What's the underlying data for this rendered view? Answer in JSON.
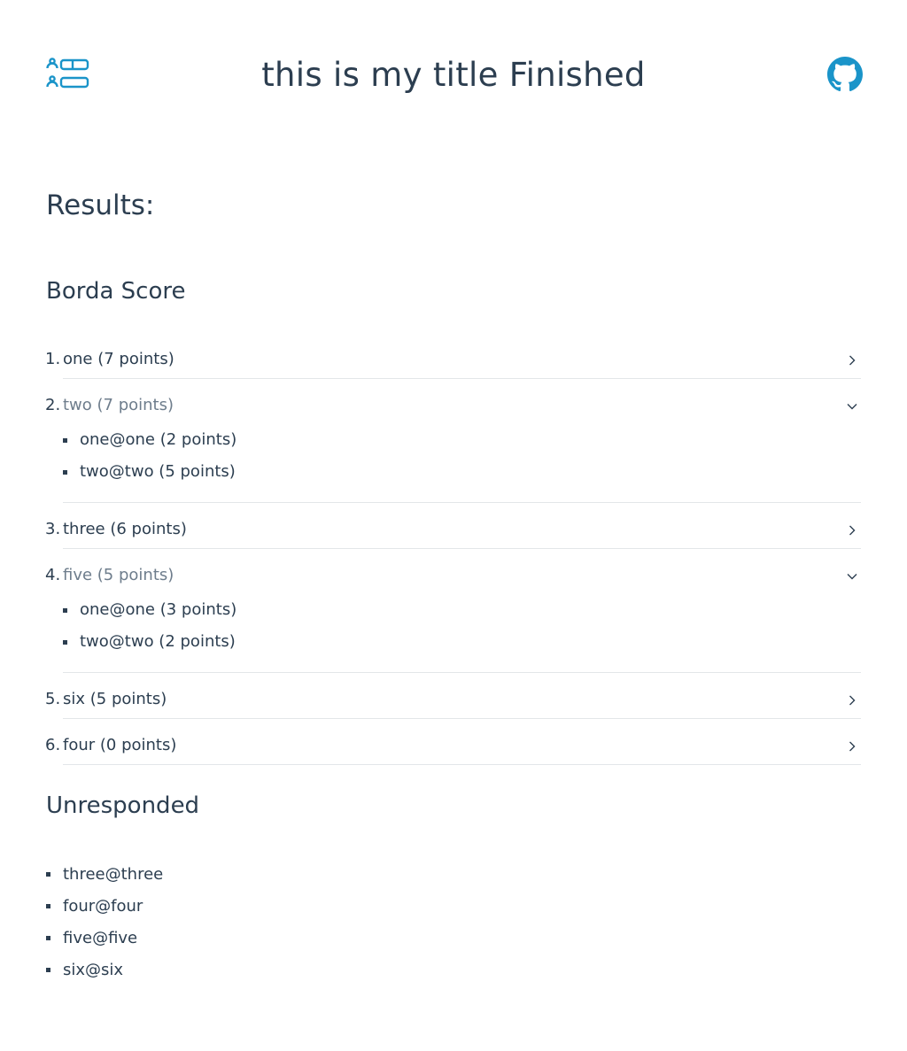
{
  "header": {
    "title": "this is my title Finished",
    "logo_icon": "ranked-list-logo-icon",
    "github_icon": "github-icon",
    "accent_color": "#1a94c9"
  },
  "results": {
    "heading": "Results:"
  },
  "borda": {
    "heading": "Borda Score",
    "items": [
      {
        "rank": "1.",
        "label": "one (7 points)",
        "expanded": false,
        "voters": []
      },
      {
        "rank": "2.",
        "label": "two (7 points)",
        "expanded": true,
        "voters": [
          "one@one (2 points)",
          "two@two (5 points)"
        ]
      },
      {
        "rank": "3.",
        "label": "three (6 points)",
        "expanded": false,
        "voters": []
      },
      {
        "rank": "4.",
        "label": "five (5 points)",
        "expanded": true,
        "voters": [
          "one@one (3 points)",
          "two@two (2 points)"
        ]
      },
      {
        "rank": "5.",
        "label": "six (5 points)",
        "expanded": false,
        "voters": []
      },
      {
        "rank": "6.",
        "label": "four (0 points)",
        "expanded": false,
        "voters": []
      }
    ]
  },
  "unresponded": {
    "heading": "Unresponded",
    "items": [
      "three@three",
      "four@four",
      "five@five",
      "six@six"
    ]
  }
}
